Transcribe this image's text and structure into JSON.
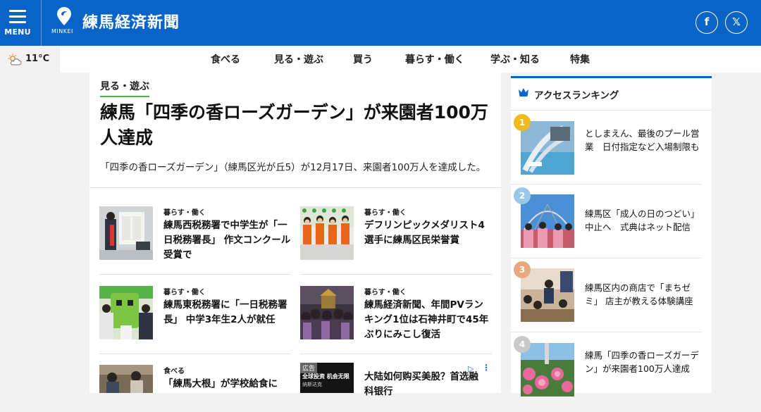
{
  "header": {
    "menu_label": "MENU",
    "logo_sub": "MINKEI",
    "site_title": "練馬経済新聞",
    "social": {
      "facebook": "f",
      "x": "𝕏"
    },
    "brand_color": "#0a63c6"
  },
  "weather": {
    "temp": "11°C",
    "icon": "sun-cloud-icon"
  },
  "nav": {
    "items": [
      "食べる",
      "見る・遊ぶ",
      "買う",
      "暮らす・働く",
      "学ぶ・知る",
      "特集"
    ]
  },
  "article": {
    "category": "見る・遊ぶ",
    "headline": "練馬「四季の香ローズガーデン」が来園者100万人達成",
    "lead": "「四季の香ローズガーデン」（練馬区光が丘5）が12月17日、来園者100万人を達成した。"
  },
  "cards": [
    {
      "category": "暮らす・働く",
      "title": "練馬西税務署で中学生が「一日税務署長」 作文コンクール受賞で"
    },
    {
      "category": "暮らす・働く",
      "title": "デフリンピックメダリスト4選手に練馬区民栄誉賞"
    },
    {
      "category": "暮らす・働く",
      "title": "練馬東税務署に「一日税務署長」 中学3年生2人が就任"
    },
    {
      "category": "暮らす・働く",
      "title": "練馬経済新聞、年間PVランキング1位は石神井町で45年ぶりにみこし復活"
    },
    {
      "category": "食べる",
      "title": "「練馬大根」が学校給食に"
    },
    {
      "category": "広告",
      "title": "大陆如何购买美股？首选融科银行"
    }
  ],
  "ad_thumb_text": [
    "全球投资 机会无限",
    "纳斯达克"
  ],
  "ranking": {
    "title": "アクセスランキング",
    "items": [
      {
        "rank": "1",
        "title": "としまえん、最後のプール営業　日付指定など入場制限も",
        "color": "#f0b91e"
      },
      {
        "rank": "2",
        "title": "練馬区「成人の日のつどい」中止へ　式典はネット配信",
        "color": "#9cc7e6"
      },
      {
        "rank": "3",
        "title": "練馬区内の商店で「まちゼミ」 店主が教える体験講座",
        "color": "#e8a87c"
      },
      {
        "rank": "4",
        "title": "練馬「四季の香ローズガーデン」が来園者100万人達成",
        "color": "#c9c9c9"
      }
    ]
  }
}
